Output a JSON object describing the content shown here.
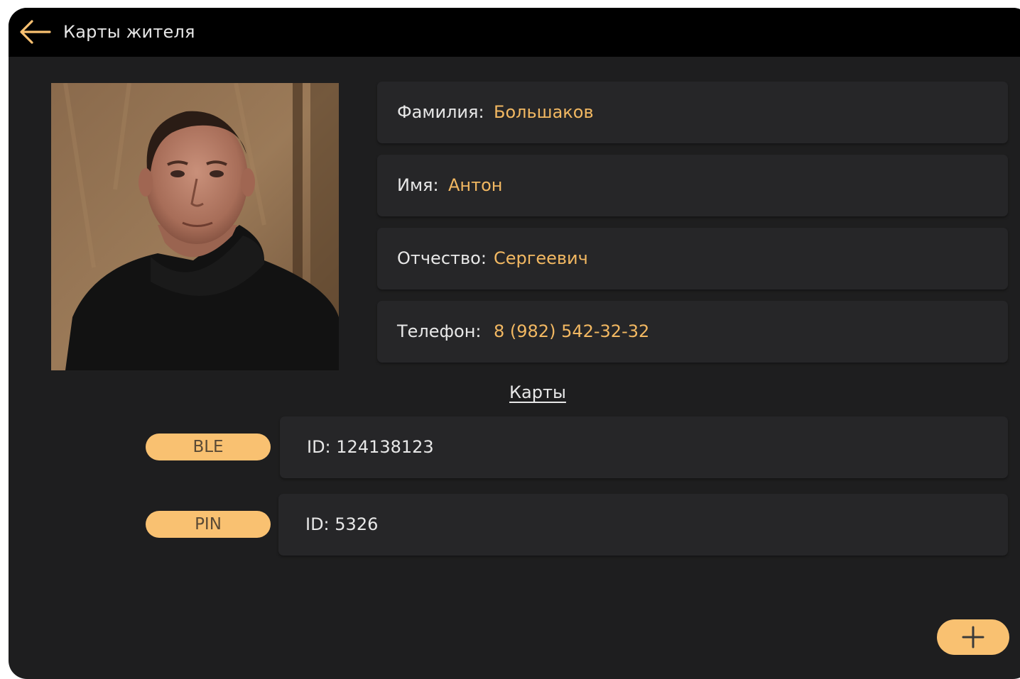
{
  "header": {
    "title": "Карты жителя",
    "back_icon": "arrow-left-icon"
  },
  "colors": {
    "accent": "#f9c171",
    "value_text": "#f2b862",
    "panel_bg": "#262628",
    "screen_bg": "#1e1e1f",
    "topbar_bg": "#000000"
  },
  "resident": {
    "surname_label": "Фамилия:",
    "surname": "Большаков",
    "name_label": "Имя:",
    "name": "Антон",
    "patronymic_label": "Отчество:",
    "patronymic": "Сергеевич",
    "phone_label": "Телефон:",
    "phone": "8 (982) 542-32-32"
  },
  "cards": {
    "heading": "Карты",
    "items": [
      {
        "type": "BLE",
        "id_text": "ID: 124138123"
      },
      {
        "type": "PIN",
        "id_text": "ID: 5326"
      }
    ]
  },
  "actions": {
    "add_icon": "plus-icon"
  }
}
